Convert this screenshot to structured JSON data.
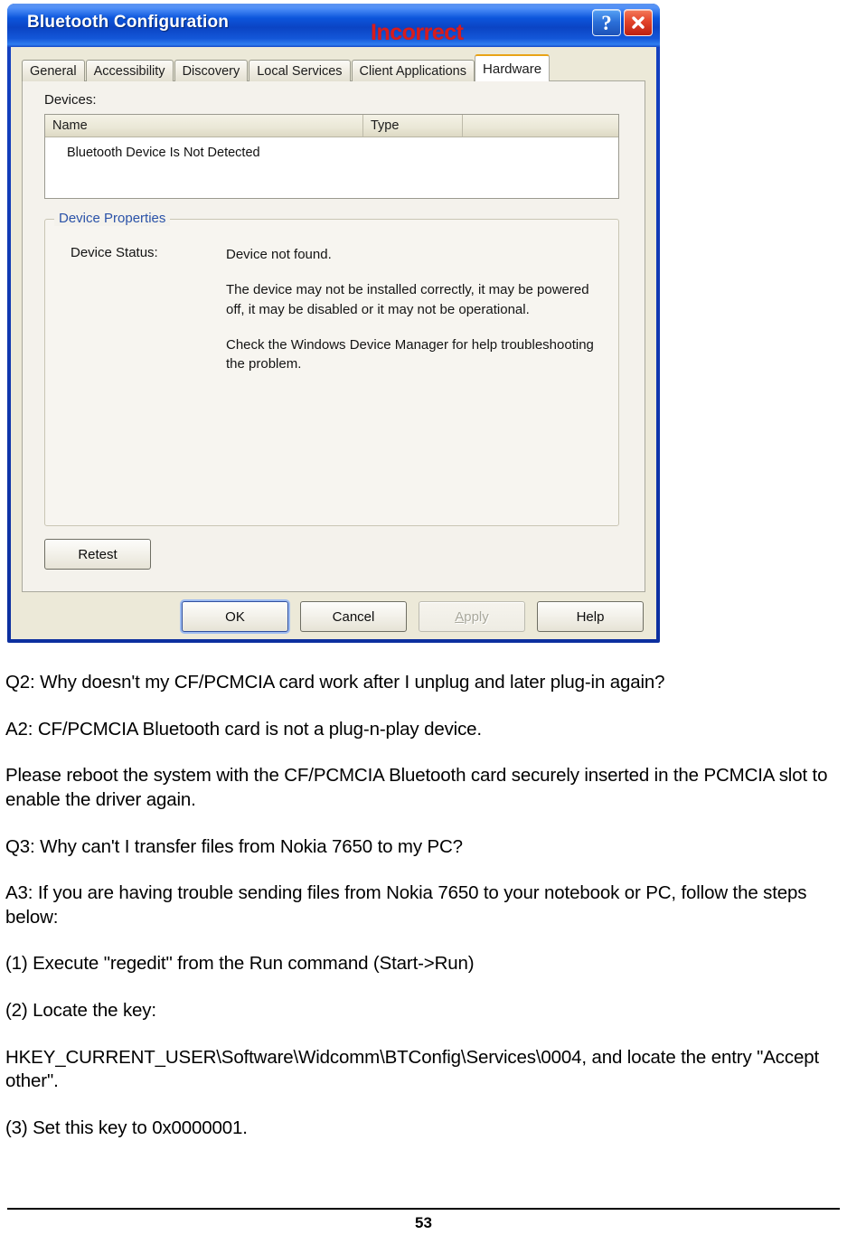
{
  "dialog": {
    "title": "Bluetooth Configuration",
    "annotation": "Incorrect",
    "title_buttons": {
      "help": "?",
      "close": "X"
    },
    "tabs": [
      {
        "label": "General",
        "active": false
      },
      {
        "label": "Accessibility",
        "active": false
      },
      {
        "label": "Discovery",
        "active": false
      },
      {
        "label": "Local Services",
        "active": false
      },
      {
        "label": "Client Applications",
        "active": false
      },
      {
        "label": "Hardware",
        "active": true
      }
    ],
    "hardware_tab": {
      "devices_label": "Devices:",
      "list": {
        "columns": [
          "Name",
          "Type"
        ],
        "rows": [
          {
            "name": "Bluetooth Device Is Not Detected",
            "type": ""
          }
        ]
      },
      "device_properties": {
        "legend": "Device Properties",
        "status_label": "Device Status:",
        "status_lines": [
          "Device not found.",
          "The device may not be installed correctly, it may be powered off, it may be disabled or it may not be operational.",
          "Check the Windows Device Manager for help troubleshooting the problem."
        ]
      },
      "retest_label": "Retest"
    },
    "buttons": {
      "ok": "OK",
      "cancel": "Cancel",
      "apply": "Apply",
      "apply_accel": "A",
      "apply_rest": "pply",
      "help": "Help"
    },
    "colors": {
      "titlebar_blue": "#0c56dd",
      "frame_blue": "#0a2a9e",
      "client_beige": "#ece9d8",
      "active_tab_accent": "#e8a317",
      "group_legend_blue": "#2a52a8",
      "annotation_red": "#d81c1c",
      "close_red": "#e2442a"
    }
  },
  "document": {
    "paragraphs": [
      "Q2: Why doesn't my CF/PCMCIA card work after I unplug and later plug-in again?",
      "A2: CF/PCMCIA Bluetooth card is not a plug-n-play device.",
      "Please reboot the system with the CF/PCMCIA Bluetooth card securely inserted in the PCMCIA slot to enable the driver again.",
      "Q3: Why can't I transfer files from Nokia 7650 to my PC?",
      "A3: If you are having trouble sending files from Nokia 7650 to your notebook or PC, follow the steps below:",
      "(1) Execute \"regedit\" from the Run command (Start->Run)",
      "(2) Locate the key:",
      "HKEY_CURRENT_USER\\Software\\Widcomm\\BTConfig\\Services\\0004, and locate the entry \"Accept other\".",
      "(3) Set this key to 0x0000001."
    ],
    "page_number": "53"
  }
}
